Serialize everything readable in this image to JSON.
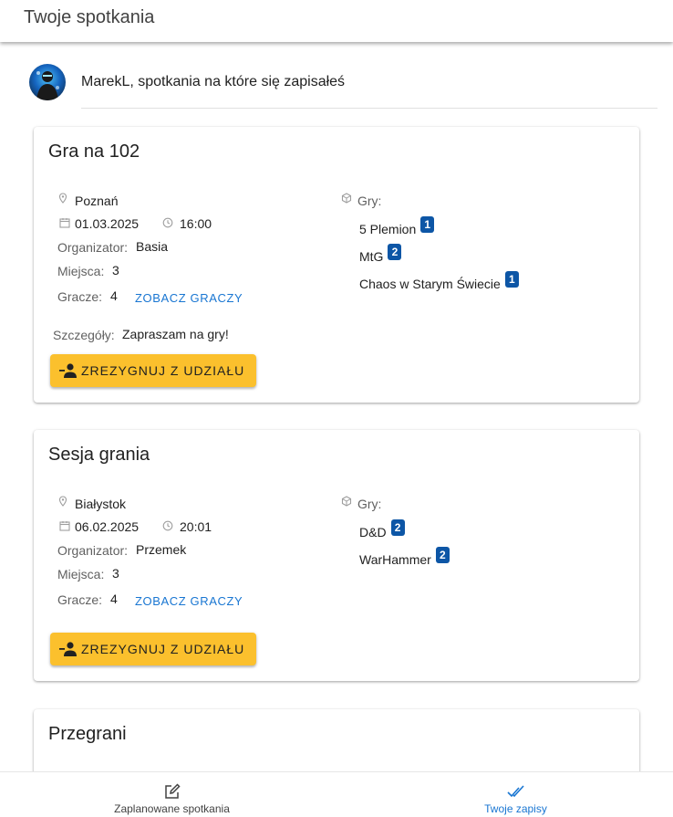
{
  "header": {
    "title": "Twoje spotkania"
  },
  "user": {
    "greeting": "MarekL, spotkania na które się zapisałeś"
  },
  "labels": {
    "organizer": "Organizator:",
    "seats": "Miejsca:",
    "players": "Gracze:",
    "details": "Szczegóły:",
    "games": "Gry:",
    "see_players": "ZOBACZ GRACZY",
    "resign": "ZREZYGNUJ Z UDZIAŁU"
  },
  "meetings": [
    {
      "title": "Gra na 102",
      "location": "Poznań",
      "date": "01.03.2025",
      "time": "16:00",
      "organizer": "Basia",
      "seats": "3",
      "players": "4",
      "details": "Zapraszam na gry!",
      "games": [
        {
          "name": "5 Plemion",
          "count": "1"
        },
        {
          "name": "MtG",
          "count": "2"
        },
        {
          "name": "Chaos w Starym Świecie",
          "count": "1"
        }
      ]
    },
    {
      "title": "Sesja grania",
      "location": "Białystok",
      "date": "06.02.2025",
      "time": "20:01",
      "organizer": "Przemek",
      "seats": "3",
      "players": "4",
      "details": "",
      "games": [
        {
          "name": "D&D",
          "count": "2"
        },
        {
          "name": "WarHammer",
          "count": "2"
        }
      ]
    },
    {
      "title": "Przegrani"
    }
  ],
  "bottom_nav": {
    "items": [
      {
        "label": "Zaplanowane spotkania",
        "icon": "edit-icon",
        "active": false
      },
      {
        "label": "Twoje zapisy",
        "icon": "double-check-icon",
        "active": true
      }
    ],
    "active_color": "#1976d2",
    "inactive_color": "#424242"
  },
  "colors": {
    "accent": "#1976d2",
    "button": "#fbc02d",
    "badge": "#0d56a6"
  }
}
